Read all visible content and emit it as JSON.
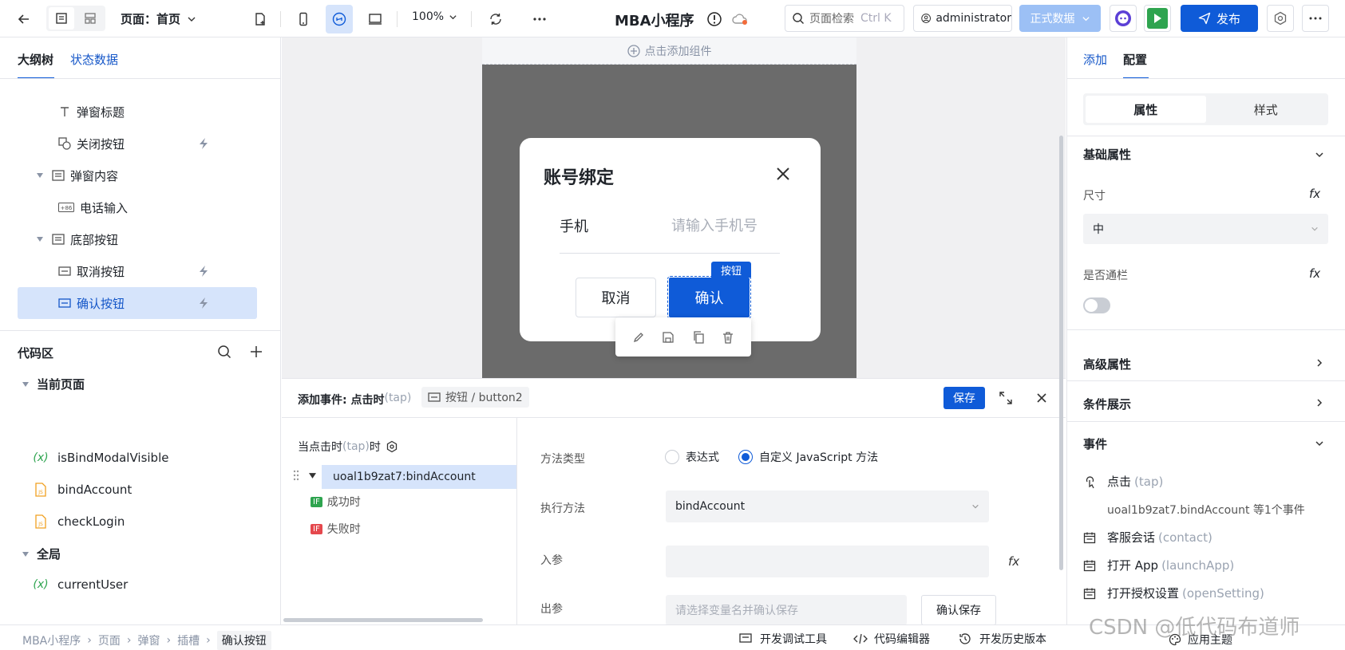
{
  "topbar": {
    "page_label": "页面：首页",
    "zoom": "100%",
    "app_title": "MBA小程序",
    "search_placeholder": "页面检索",
    "search_shortcut": "Ctrl K",
    "user": "administrator",
    "data_mode": "正式数据",
    "publish": "发布"
  },
  "left": {
    "tabs": [
      "大纲树",
      "状态数据"
    ],
    "tree": [
      {
        "label": "弹窗标题",
        "icon": "text-icon"
      },
      {
        "label": "关闭按钮",
        "icon": "close-button-icon",
        "bolt": true
      },
      {
        "label": "弹窗内容",
        "icon": "container-icon",
        "expand": true
      },
      {
        "label": "电话输入",
        "icon": "phone-input-icon"
      },
      {
        "label": "底部按钮",
        "icon": "container-icon",
        "expand": true
      },
      {
        "label": "取消按钮",
        "icon": "button-icon",
        "bolt": true
      },
      {
        "label": "确认按钮",
        "icon": "button-icon",
        "bolt": true,
        "selected": true
      }
    ],
    "code_title": "代码区",
    "current_page": "当前页面",
    "current_items": [
      {
        "label": "isBindModalVisible",
        "icon": "variable-icon"
      },
      {
        "label": "bindAccount",
        "icon": "js-file-icon"
      },
      {
        "label": "checkLogin",
        "icon": "js-file-icon"
      }
    ],
    "global": "全局",
    "global_items": [
      {
        "label": "currentUser",
        "icon": "variable-icon"
      }
    ]
  },
  "canvas": {
    "add_component": "点击添加组件",
    "modal_title": "账号绑定",
    "phone_label": "手机",
    "phone_placeholder": "请输入手机号",
    "cancel": "取消",
    "confirm": "确认",
    "selected_tag": "按钮"
  },
  "event": {
    "title": "添加事件: 点击时",
    "title_tap": "(tap)",
    "target": "按钮 / button2",
    "save": "保存",
    "trigger": "当点击时",
    "trigger_tap": "(tap)",
    "trigger_suffix": "时",
    "action": "uoal1b9zat7:bindAccount",
    "success": "成功时",
    "fail": "失败时",
    "if": "IF",
    "method_type_label": "方法类型",
    "opt_expression": "表达式",
    "opt_custom": "自定义 JavaScript 方法",
    "exec_label": "执行方法",
    "exec_value": "bindAccount",
    "in_label": "入参",
    "out_label": "出参",
    "out_placeholder": "请选择变量名并确认保存",
    "confirm_save": "确认保存"
  },
  "right": {
    "tabs": [
      "添加",
      "配置"
    ],
    "seg": [
      "属性",
      "样式"
    ],
    "basic": "基础属性",
    "size_label": "尺寸",
    "size_value": "中",
    "block_label": "是否通栏",
    "advanced": "高级属性",
    "condition": "条件展示",
    "events": "事件",
    "ev_click": "点击",
    "ev_click_tap": "(tap)",
    "ev_click_detail": "uoal1b9zat7.bindAccount 等1个事件",
    "ev_contact": "客服会话",
    "ev_contact_code": "(contact)",
    "ev_launch": "打开 App",
    "ev_launch_code": "(launchApp)",
    "ev_setting": "打开授权设置",
    "ev_setting_code": "(openSetting)"
  },
  "bottom": {
    "crumbs": [
      "MBA小程序",
      "页面",
      "弹窗",
      "插槽",
      "确认按钮"
    ],
    "devtools": "开发调试工具",
    "code_editor": "代码编辑器",
    "history": "开发历史版本",
    "theme": "应用主题",
    "watermark": "CSDN @低代码布道师"
  },
  "colors": {
    "primary": "#0f5bd8",
    "selected_bg": "#d6e4fb",
    "run_green": "#2ea44f"
  }
}
